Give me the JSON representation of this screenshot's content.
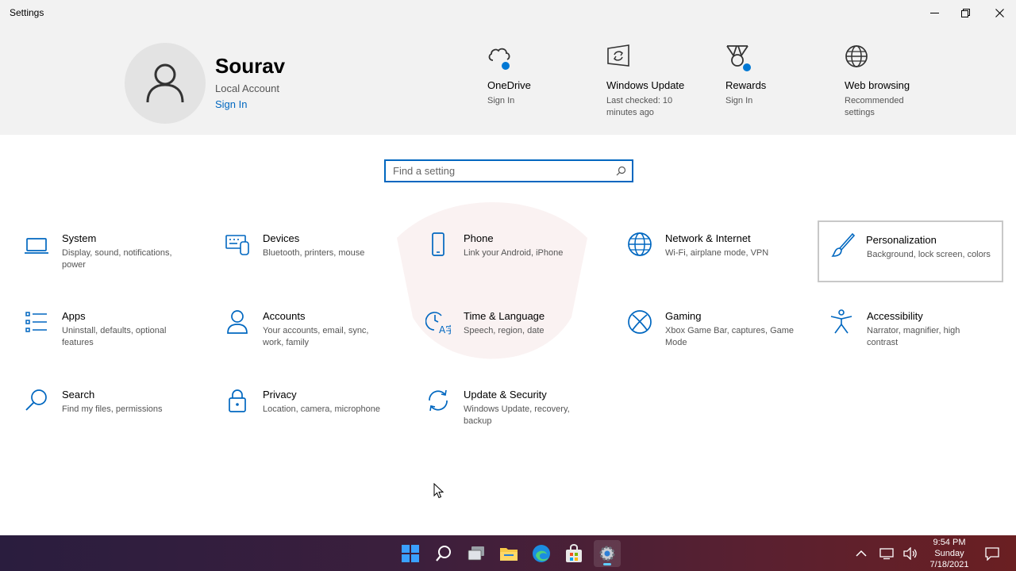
{
  "window": {
    "title": "Settings"
  },
  "user": {
    "name": "Sourav",
    "account_type": "Local Account",
    "sign_in": "Sign In"
  },
  "quick_links": [
    {
      "title": "OneDrive",
      "subtitle": "Sign In",
      "icon": "cloud-icon"
    },
    {
      "title": "Windows Update",
      "subtitle": "Last checked: 10 minutes ago",
      "icon": "sync-icon"
    },
    {
      "title": "Rewards",
      "subtitle": "Sign In",
      "icon": "medal-icon"
    },
    {
      "title": "Web browsing",
      "subtitle": "Recommended settings",
      "icon": "globe-icon"
    }
  ],
  "search": {
    "placeholder": "Find a setting"
  },
  "categories": [
    {
      "title": "System",
      "desc": "Display, sound, notifications, power",
      "icon": "laptop-icon"
    },
    {
      "title": "Devices",
      "desc": "Bluetooth, printers, mouse",
      "icon": "keyboard-icon"
    },
    {
      "title": "Phone",
      "desc": "Link your Android, iPhone",
      "icon": "phone-icon"
    },
    {
      "title": "Network & Internet",
      "desc": "Wi-Fi, airplane mode, VPN",
      "icon": "globe-icon"
    },
    {
      "title": "Personalization",
      "desc": "Background, lock screen, colors",
      "icon": "brush-icon"
    },
    {
      "title": "Apps",
      "desc": "Uninstall, defaults, optional features",
      "icon": "list-icon"
    },
    {
      "title": "Accounts",
      "desc": "Your accounts, email, sync, work, family",
      "icon": "person-icon"
    },
    {
      "title": "Time & Language",
      "desc": "Speech, region, date",
      "icon": "clock-language-icon"
    },
    {
      "title": "Gaming",
      "desc": "Xbox Game Bar, captures, Game Mode",
      "icon": "xbox-icon"
    },
    {
      "title": "Accessibility",
      "desc": "Narrator, magnifier, high contrast",
      "icon": "accessibility-icon"
    },
    {
      "title": "Search",
      "desc": "Find my files, permissions",
      "icon": "search-icon"
    },
    {
      "title": "Privacy",
      "desc": "Location, camera, microphone",
      "icon": "lock-icon"
    },
    {
      "title": "Update & Security",
      "desc": "Windows Update, recovery, backup",
      "icon": "sync-icon"
    }
  ],
  "taskbar": {
    "clock": {
      "time": "9:54 PM",
      "day": "Sunday",
      "date": "7/18/2021"
    }
  },
  "colors": {
    "accent": "#0067c0",
    "badge": "#0078d4",
    "header_bg": "#f2f2f2"
  }
}
